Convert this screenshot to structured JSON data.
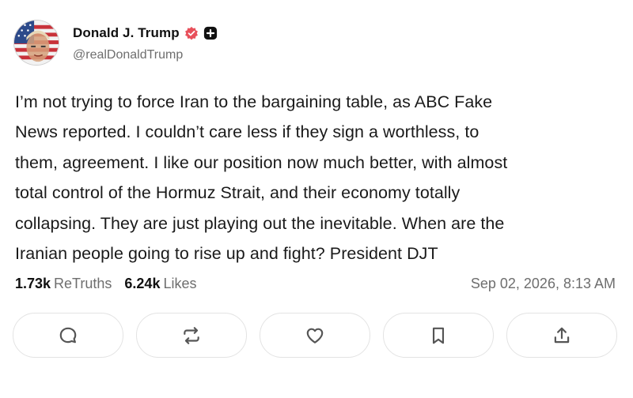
{
  "author": {
    "display_name": "Donald J. Trump",
    "handle": "@realDonaldTrump",
    "verified_icon": "verified-badge-icon",
    "extra_icon": "plus-badge-icon",
    "verified_color": "#e8505b"
  },
  "post": {
    "text": "I’m not trying to force Iran to the bargaining table, as ABC Fake\nNews reported. I couldn’t care less if they sign a worthless, to\nthem, agreement. I like our position now much better, with almost\ntotal control of the Hormuz Strait, and their economy totally\ncollapsing. They are just playing out the inevitable. When are the\nIranian people going to rise up and fight? President DJT"
  },
  "stats": {
    "retruths_count": "1.73k",
    "retruths_label": "ReTruths",
    "likes_count": "6.24k",
    "likes_label": "Likes",
    "timestamp": "Sep 02, 2026, 8:13 AM"
  },
  "actions": [
    {
      "name": "reply",
      "icon": "comment-icon"
    },
    {
      "name": "retruth",
      "icon": "repost-icon"
    },
    {
      "name": "like",
      "icon": "heart-icon"
    },
    {
      "name": "bookmark",
      "icon": "bookmark-icon"
    },
    {
      "name": "share",
      "icon": "share-icon"
    }
  ]
}
